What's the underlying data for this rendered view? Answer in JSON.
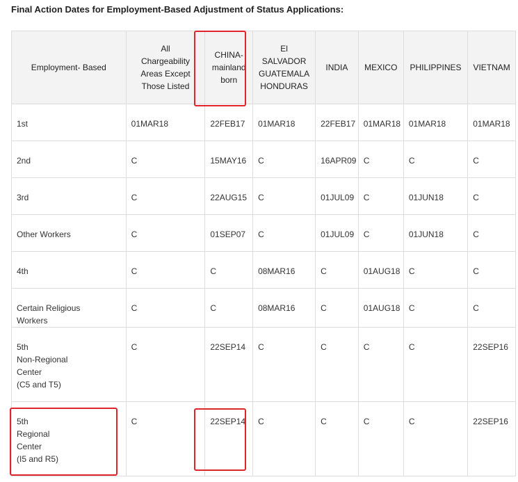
{
  "page": {
    "title": "Final Action Dates for Employment-Based Adjustment of Status Applications:"
  },
  "table": {
    "headers": [
      "Employment- Based",
      "All\nChargeability\nAreas Except\nThose Listed",
      "CHINA-\nmainland\nborn",
      "El\nSALVADOR\nGUATEMALA\nHONDURAS",
      "INDIA",
      "MEXICO",
      "PHILIPPINES",
      "VIETNAM"
    ],
    "rows": [
      [
        "1st",
        "01MAR18",
        "22FEB17",
        "01MAR18",
        "22FEB17",
        "01MAR18",
        "01MAR18",
        "01MAR18"
      ],
      [
        "2nd",
        "C",
        "15MAY16",
        "C",
        "16APR09",
        "C",
        "C",
        "C"
      ],
      [
        "3rd",
        "C",
        "22AUG15",
        "C",
        "01JUL09",
        "C",
        "01JUN18",
        "C"
      ],
      [
        "Other Workers",
        "C",
        "01SEP07",
        "C",
        "01JUL09",
        "C",
        "01JUN18",
        "C"
      ],
      [
        "4th",
        "C",
        "C",
        "08MAR16",
        "C",
        "01AUG18",
        "C",
        "C"
      ],
      [
        "Certain Religious\nWorkers",
        "C",
        "C",
        "08MAR16",
        "C",
        "01AUG18",
        "C",
        "C"
      ],
      [
        "5th\nNon-Regional\nCenter\n(C5 and T5)",
        "C",
        "22SEP14",
        "C",
        "C",
        "C",
        "C",
        "22SEP16"
      ],
      [
        "5th\nRegional\nCenter\n(I5 and R5)",
        "C",
        "22SEP14",
        "C",
        "C",
        "C",
        "C",
        "22SEP16"
      ]
    ]
  },
  "colors": {
    "highlight": "#e0242b",
    "header_bg": "#f3f3f3",
    "border": "#dddddd"
  }
}
